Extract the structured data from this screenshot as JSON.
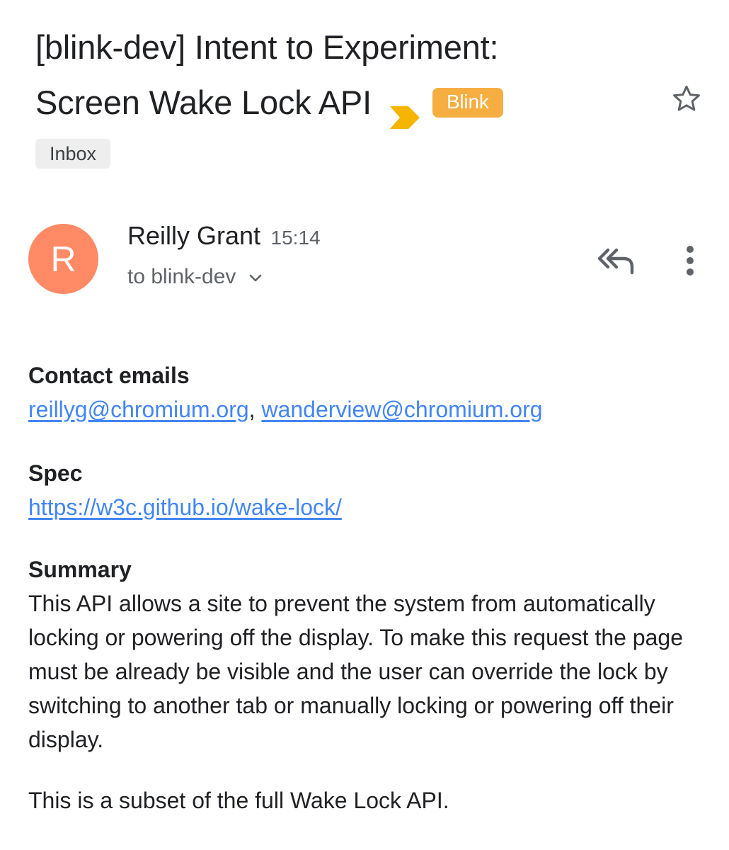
{
  "subject": {
    "line1": "[blink-dev] Intent to Experiment:",
    "line2": "Screen Wake Lock API",
    "label": "Blink",
    "folder_chip": "Inbox",
    "star_icon": "star-outline-icon",
    "importance_icon": "importance-marker-icon"
  },
  "message": {
    "avatar_initial": "R",
    "sender_name": "Reilly Grant",
    "time": "15:14",
    "recipients": "to blink-dev",
    "reply_icon": "reply-all-icon",
    "more_icon": "more-vert-icon"
  },
  "body": {
    "contact": {
      "heading": "Contact emails",
      "email1": "reillyg@chromium.org",
      "separator": ",",
      "email2": "wanderview@chromium.org"
    },
    "spec": {
      "heading": "Spec",
      "url": "https://w3c.github.io/wake-lock/"
    },
    "summary": {
      "heading": "Summary",
      "text": "This API allows a site to prevent the system from automatically locking or powering off the display. To make this request the page must be already be visible and the user can override the lock by switching to another tab or manually locking or powering off their display.",
      "note": "This is a subset of the full Wake Lock API."
    }
  },
  "colors": {
    "label_bg": "#f6ae40",
    "importance_marker": "#f4b400",
    "avatar_bg": "#ff8a65",
    "link": "#4285f4",
    "secondary_text": "#5f6368"
  }
}
